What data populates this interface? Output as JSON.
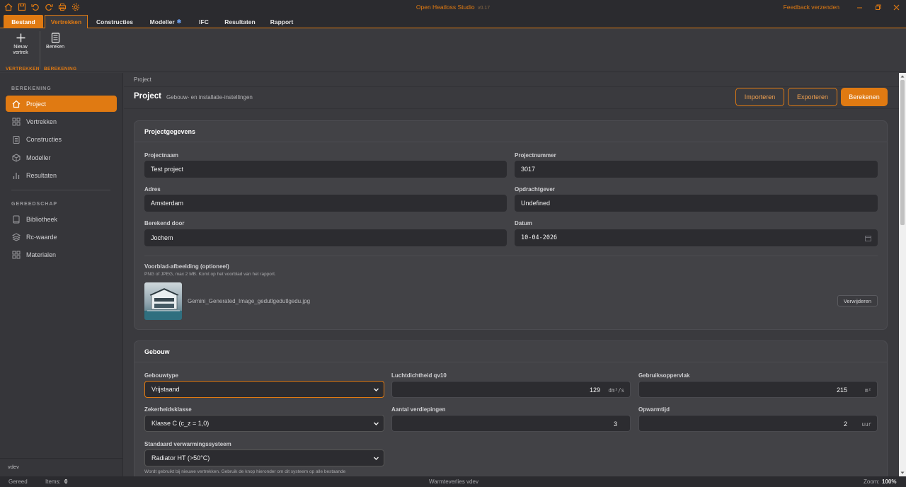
{
  "app": {
    "title": "Open Heatloss Studio",
    "version": "v0.17",
    "feedback": "Feedback verzenden"
  },
  "tabs": [
    "Bestand",
    "Vertrekken",
    "Constructies",
    "Modeller",
    "IFC",
    "Resultaten",
    "Rapport"
  ],
  "ribbon": {
    "new_room": "Nieuw vertrek",
    "calculate": "Bereken",
    "group_rooms": "VERTREKKEN",
    "group_calc": "BEREKENING"
  },
  "sidebar": {
    "section1": "BEREKENING",
    "items1": [
      "Project",
      "Vertrekken",
      "Constructies",
      "Modeller",
      "Resultaten"
    ],
    "section2": "GEREEDSCHAP",
    "items2": [
      "Bibliotheek",
      "Rc-waarde",
      "Materialen"
    ],
    "user": "vdev"
  },
  "page": {
    "breadcrumb": "Project",
    "title": "Project",
    "subtitle": "Gebouw- en installatie-instellingen",
    "btn_import": "Importeren",
    "btn_export": "Exporteren",
    "btn_calc": "Berekenen"
  },
  "project": {
    "heading": "Projectgegevens",
    "name_label": "Projectnaam",
    "name": "Test project",
    "number_label": "Projectnummer",
    "number": "3017",
    "address_label": "Adres",
    "address": "Amsterdam",
    "client_label": "Opdrachtgever",
    "client": "Undefined",
    "by_label": "Berekend door",
    "by": "Jochem",
    "date_label": "Datum",
    "date": "10-04-2026",
    "cover_label": "Voorblad-afbeelding (optioneel)",
    "cover_hint": "PNG of JPEG, max 2 MB. Komt op het voorblad van het rapport.",
    "cover_file": "Gemini_Generated_Image_gedutlgedutlgedu.jpg",
    "remove": "Verwijderen"
  },
  "building": {
    "heading": "Gebouw",
    "type_label": "Gebouwtype",
    "type": "Vrijstaand",
    "air_label": "Luchtdichtheid qv10",
    "air": "129",
    "air_unit": "dm³/s",
    "area_label": "Gebruiksoppervlak",
    "area": "215",
    "area_unit": "m²",
    "safety_label": "Zekerheidsklasse",
    "safety": "Klasse C (c_z = 1,0)",
    "floors_label": "Aantal verdiepingen",
    "floors": "3",
    "warmup_label": "Opwarmtijd",
    "warmup": "2",
    "warmup_unit": "uur",
    "heating_label": "Standaard verwarmingssysteem",
    "heating": "Radiator HT (>50°C)",
    "heating_hint": "Wordt gebruikt bij nieuwe vertrekken. Gebruik de knop hieronder om dit systeem op alle bestaande"
  },
  "status": {
    "ready": "Gereed",
    "items_label": "Items:",
    "items": "0",
    "center": "Warmteverlies vdev",
    "zoom_label": "Zoom:",
    "zoom": "100%"
  },
  "colors": {
    "accent": "#e07a12",
    "background": "#3a3a3e",
    "panel": "#424246"
  }
}
